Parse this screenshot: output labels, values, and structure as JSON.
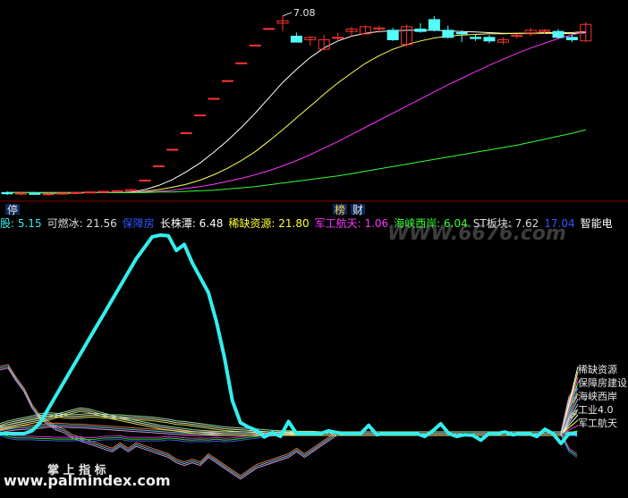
{
  "colors": {
    "background": "#000000",
    "divider": "#8b0000",
    "up_candle": "#ff3333",
    "down_candle": "#54fcfc",
    "ma_white": "#ffffff",
    "ma_yellow": "#ffff54",
    "ma_magenta": "#ff33ff",
    "ma_green": "#33ff33",
    "cyan_line": "#33eeee",
    "badge_bg": "#0a2a5a",
    "badge_text": "#e8e8e8",
    "badge_text_2": "#ffd24d"
  },
  "top_panel": {
    "high_label": "7.08",
    "badges": [
      "停",
      "榜",
      "财"
    ]
  },
  "legend_bar": {
    "items": [
      {
        "name": "股",
        "value": "5.15",
        "color": "#33eeee"
      },
      {
        "name": "可燃冰",
        "value": "21.56",
        "color": "#dddddd"
      },
      {
        "name": "保障房",
        "value": "",
        "color": "#3355ff"
      },
      {
        "name": "长株潭",
        "value": "6.48",
        "color": "#ffffff"
      },
      {
        "name": "稀缺资源",
        "value": "21.80",
        "color": "#ffff33"
      },
      {
        "name": "军工航天",
        "value": "1.06",
        "color": "#ff33ff"
      },
      {
        "name": "海峡西岸",
        "value": "6.04",
        "color": "#33ff33"
      },
      {
        "name": "ST板块",
        "value": "7.62",
        "color": "#dddddd"
      },
      {
        "name": "",
        "value": "17.04",
        "color": "#3355ff"
      },
      {
        "name": "智能电",
        "value": "",
        "color": "#ffffff"
      }
    ],
    "sep": ":"
  },
  "watermarks": {
    "top": "WWW.6676.com",
    "bottom": "www.palmindex.com"
  },
  "bottom_panel": {
    "caption": "掌 上 指 标",
    "right_labels": [
      "稀缺资源",
      "保障房建设",
      "海峡西岸",
      "工业4.0",
      "军工航天"
    ]
  },
  "chart_data": [
    {
      "type": "candlestick",
      "title": "",
      "annotation": "7.08",
      "ohlc": [
        {
          "o": 4.1,
          "h": 4.12,
          "l": 4.06,
          "c": 4.08
        },
        {
          "o": 4.08,
          "h": 4.1,
          "l": 4.05,
          "c": 4.09
        },
        {
          "o": 4.09,
          "h": 4.11,
          "l": 4.06,
          "c": 4.07
        },
        {
          "o": 4.07,
          "h": 4.1,
          "l": 4.05,
          "c": 4.08
        },
        {
          "o": 4.08,
          "h": 4.1,
          "l": 4.06,
          "c": 4.09
        },
        {
          "o": 4.09,
          "h": 4.11,
          "l": 4.07,
          "c": 4.1
        },
        {
          "o": 4.1,
          "h": 4.12,
          "l": 4.08,
          "c": 4.11
        },
        {
          "o": 4.11,
          "h": 4.13,
          "l": 4.09,
          "c": 4.12
        },
        {
          "o": 4.12,
          "h": 4.14,
          "l": 4.1,
          "c": 4.13
        },
        {
          "o": 4.13,
          "h": 4.16,
          "l": 4.12,
          "c": 4.15
        },
        {
          "o": 4.3,
          "h": 4.32,
          "l": 4.29,
          "c": 4.31
        },
        {
          "o": 4.54,
          "h": 4.56,
          "l": 4.53,
          "c": 4.55
        },
        {
          "o": 4.82,
          "h": 4.84,
          "l": 4.81,
          "c": 4.83
        },
        {
          "o": 5.1,
          "h": 5.12,
          "l": 5.09,
          "c": 5.11
        },
        {
          "o": 5.4,
          "h": 5.42,
          "l": 5.39,
          "c": 5.41
        },
        {
          "o": 5.68,
          "h": 5.7,
          "l": 5.67,
          "c": 5.69
        },
        {
          "o": 5.98,
          "h": 6.0,
          "l": 5.97,
          "c": 5.99
        },
        {
          "o": 6.28,
          "h": 6.3,
          "l": 6.27,
          "c": 6.29
        },
        {
          "o": 6.58,
          "h": 6.6,
          "l": 6.57,
          "c": 6.59
        },
        {
          "o": 6.86,
          "h": 6.88,
          "l": 6.85,
          "c": 6.87
        },
        {
          "o": 6.96,
          "h": 7.08,
          "l": 6.82,
          "c": 7.0
        },
        {
          "o": 6.74,
          "h": 6.8,
          "l": 6.66,
          "c": 6.64
        },
        {
          "o": 6.68,
          "h": 6.74,
          "l": 6.58,
          "c": 6.72
        },
        {
          "o": 6.52,
          "h": 6.76,
          "l": 6.5,
          "c": 6.68
        },
        {
          "o": 6.72,
          "h": 6.8,
          "l": 6.66,
          "c": 6.72
        },
        {
          "o": 6.82,
          "h": 6.9,
          "l": 6.74,
          "c": 6.86
        },
        {
          "o": 6.78,
          "h": 6.92,
          "l": 6.76,
          "c": 6.9
        },
        {
          "o": 6.86,
          "h": 6.92,
          "l": 6.8,
          "c": 6.88
        },
        {
          "o": 6.84,
          "h": 6.88,
          "l": 6.66,
          "c": 6.68
        },
        {
          "o": 6.6,
          "h": 6.94,
          "l": 6.56,
          "c": 6.9
        },
        {
          "o": 6.86,
          "h": 6.96,
          "l": 6.8,
          "c": 6.82
        },
        {
          "o": 7.02,
          "h": 7.08,
          "l": 6.82,
          "c": 6.84
        },
        {
          "o": 6.84,
          "h": 6.92,
          "l": 6.7,
          "c": 6.72
        },
        {
          "o": 6.8,
          "h": 6.84,
          "l": 6.64,
          "c": 6.78
        },
        {
          "o": 6.72,
          "h": 6.76,
          "l": 6.66,
          "c": 6.7
        },
        {
          "o": 6.72,
          "h": 6.76,
          "l": 6.62,
          "c": 6.66
        },
        {
          "o": 6.64,
          "h": 6.72,
          "l": 6.6,
          "c": 6.68
        },
        {
          "o": 6.74,
          "h": 6.78,
          "l": 6.7,
          "c": 6.76
        },
        {
          "o": 6.78,
          "h": 6.88,
          "l": 6.74,
          "c": 6.84
        },
        {
          "o": 6.82,
          "h": 6.86,
          "l": 6.78,
          "c": 6.84
        },
        {
          "o": 6.82,
          "h": 6.86,
          "l": 6.7,
          "c": 6.72
        },
        {
          "o": 6.72,
          "h": 6.76,
          "l": 6.64,
          "c": 6.68
        },
        {
          "o": 6.66,
          "h": 6.98,
          "l": 6.64,
          "c": 6.94
        }
      ],
      "moving_averages": [
        {
          "color": "white",
          "values": [
            4.1,
            4.1,
            4.1,
            4.09,
            4.09,
            4.09,
            4.1,
            4.1,
            4.1,
            4.11,
            4.15,
            4.22,
            4.32,
            4.45,
            4.6,
            4.78,
            4.98,
            5.2,
            5.44,
            5.7,
            5.96,
            6.18,
            6.38,
            6.54,
            6.66,
            6.74,
            6.79,
            6.82,
            6.83,
            6.84,
            6.84,
            6.84,
            6.83,
            6.82,
            6.81,
            6.8,
            6.79,
            6.79,
            6.79,
            6.79,
            6.79,
            6.78,
            6.8
          ]
        },
        {
          "color": "yellow",
          "values": [
            4.1,
            4.1,
            4.1,
            4.1,
            4.1,
            4.1,
            4.1,
            4.1,
            4.1,
            4.1,
            4.12,
            4.15,
            4.19,
            4.24,
            4.31,
            4.4,
            4.51,
            4.64,
            4.79,
            4.97,
            5.16,
            5.36,
            5.56,
            5.76,
            5.95,
            6.12,
            6.28,
            6.41,
            6.52,
            6.6,
            6.66,
            6.71,
            6.74,
            6.76,
            6.77,
            6.78,
            6.78,
            6.79,
            6.79,
            6.8,
            6.8,
            6.8,
            6.82
          ]
        },
        {
          "color": "magenta",
          "values": [
            4.1,
            4.1,
            4.1,
            4.1,
            4.1,
            4.1,
            4.1,
            4.1,
            4.1,
            4.1,
            4.11,
            4.12,
            4.14,
            4.17,
            4.2,
            4.24,
            4.29,
            4.34,
            4.4,
            4.47,
            4.55,
            4.64,
            4.74,
            4.85,
            4.96,
            5.08,
            5.2,
            5.32,
            5.44,
            5.56,
            5.68,
            5.8,
            5.92,
            6.03,
            6.14,
            6.25,
            6.35,
            6.45,
            6.54,
            6.62,
            6.7,
            6.76,
            6.82
          ]
        },
        {
          "color": "green",
          "values": [
            4.1,
            4.1,
            4.1,
            4.1,
            4.1,
            4.1,
            4.1,
            4.1,
            4.1,
            4.1,
            4.1,
            4.11,
            4.11,
            4.12,
            4.13,
            4.14,
            4.16,
            4.18,
            4.2,
            4.23,
            4.26,
            4.29,
            4.32,
            4.35,
            4.38,
            4.42,
            4.46,
            4.5,
            4.54,
            4.58,
            4.62,
            4.66,
            4.7,
            4.74,
            4.78,
            4.82,
            4.86,
            4.9,
            4.95,
            5.0,
            5.05,
            5.1,
            5.16
          ]
        }
      ]
    },
    {
      "type": "line",
      "title": "",
      "series": [
        {
          "color": "cyan",
          "values": [
            0,
            0,
            0,
            0,
            0.5,
            2,
            4.5,
            7,
            9.5,
            12,
            14.5,
            17,
            19.5,
            22,
            24.5,
            27,
            29.5,
            32,
            34,
            36,
            36.3,
            36.2,
            33.5,
            34.6,
            31.2,
            28.5,
            25.8,
            20.5,
            14,
            6,
            2,
            1.2,
            0.6,
            -0.6,
            0.2,
            -0.5,
            2.2,
            0,
            0,
            0,
            0,
            0.5,
            0.2,
            0,
            0,
            0,
            1.5,
            -0.2,
            0,
            0,
            0,
            0,
            0,
            -0.5,
            0.5,
            1.8,
            0,
            -0.5,
            -0.2,
            -0.3,
            -1.2,
            0,
            0,
            0.3,
            -0.2,
            0,
            0,
            -0.5,
            0.8,
            0,
            -1.8,
            0,
            0
          ]
        },
        {
          "color": "white",
          "values": [
            12,
            12.3,
            10,
            8,
            5,
            3,
            2,
            1,
            0.5,
            -0.5,
            -1,
            -1.5,
            -2,
            -2.5,
            -3,
            -2,
            -3,
            -2,
            -2.5,
            -3,
            -3.5,
            -4,
            -5,
            -5.5,
            -5,
            -5.5,
            -4,
            -5,
            -6,
            -7,
            -8,
            -7,
            -6,
            -5.5,
            -5,
            -4.5,
            -4,
            -3,
            -4,
            -3,
            -2,
            -1,
            0,
            0,
            0,
            0,
            0,
            0,
            0,
            0,
            0,
            0,
            0,
            0,
            0,
            0,
            0,
            0,
            0,
            0,
            0,
            0,
            0,
            0,
            0,
            0,
            0,
            0,
            0,
            0,
            0,
            0,
            0
          ]
        },
        {
          "color": "yellow",
          "values": [
            1.5,
            2,
            2.3,
            2.6,
            2.9,
            3.3,
            3.5,
            3.4,
            3.2,
            3.1,
            3.2,
            3.3,
            3.3,
            3.2,
            3.1,
            3.1,
            3,
            2.9,
            2.8,
            2.7,
            2.5,
            2.3,
            2,
            1.9,
            1.7,
            1.5,
            1.3,
            1.1,
            0.9,
            0.8,
            0.7,
            0.6,
            0.5,
            0.4,
            0.3,
            0.2,
            0.2,
            0.1,
            0.1,
            0.1,
            0,
            0,
            0,
            0,
            0,
            0,
            0,
            0,
            0,
            0,
            0,
            0,
            0,
            0,
            0,
            0,
            0,
            0,
            0,
            0,
            0,
            0,
            0,
            0,
            0,
            0,
            0,
            0,
            0,
            0,
            0,
            5,
            7
          ]
        },
        {
          "color": "magenta",
          "values": [
            0,
            -0.5,
            -0.8,
            -0.8,
            -0.8,
            -0.9,
            -0.9,
            -1,
            -1,
            -1,
            -0.9,
            -1.1,
            -1,
            -0.8,
            -0.8,
            -0.7,
            -1,
            -1,
            -1,
            -1,
            -1,
            -0.8,
            -0.9,
            -1.1,
            -1.2,
            -1.1,
            -1.2,
            -1,
            -1.2,
            -1.1,
            -0.9,
            -0.7,
            -0.5,
            -0.3,
            -0.1,
            0,
            0,
            0,
            0,
            0,
            0,
            0,
            0,
            0,
            0,
            0,
            0,
            0,
            0,
            0,
            0,
            0,
            0,
            0,
            0,
            0,
            0,
            0,
            0,
            0,
            0,
            0,
            0,
            0,
            0,
            0,
            0,
            0,
            0,
            0,
            0,
            -3,
            -4
          ]
        },
        {
          "color": "green",
          "values": [
            0.5,
            0.8,
            1,
            1.1,
            1.2,
            1.3,
            1.5,
            1.6,
            1.5,
            1.4,
            1.4,
            1.3,
            1.2,
            1.1,
            1,
            0.9,
            0.8,
            0.7,
            0.6,
            0.5,
            0.4,
            0.3,
            0.2,
            0.1,
            0,
            0,
            0,
            0,
            0,
            0,
            0,
            0,
            0,
            0,
            0,
            0,
            0,
            0,
            0,
            0,
            0,
            0,
            0,
            0,
            0,
            0,
            0,
            0,
            0,
            0,
            0,
            0,
            0,
            0,
            0,
            0,
            0,
            0,
            0,
            0,
            0,
            0,
            0,
            0,
            0,
            0,
            0,
            0,
            0,
            0,
            0,
            6.5,
            8.5
          ]
        },
        {
          "color": "blue",
          "values": [
            1,
            1.3,
            1.6,
            1.9,
            2.2,
            2.5,
            2.8,
            3.2,
            3.6,
            4,
            4.4,
            4.2,
            3.8,
            3.4,
            3,
            2.7,
            2.4,
            2.1,
            1.8,
            1.5,
            1.2,
            1,
            0.8,
            0.6,
            0.4,
            0.3,
            0.2,
            0.1,
            0,
            0,
            0,
            0,
            0,
            0,
            0,
            0,
            0,
            0,
            0,
            0,
            0,
            0,
            0,
            0,
            0,
            0,
            0,
            0,
            0,
            0,
            0,
            0,
            0,
            0,
            0,
            0,
            0,
            0,
            0,
            0,
            0,
            0,
            0,
            0,
            0,
            0,
            0,
            0,
            0,
            0,
            0,
            3,
            4
          ]
        }
      ]
    }
  ]
}
